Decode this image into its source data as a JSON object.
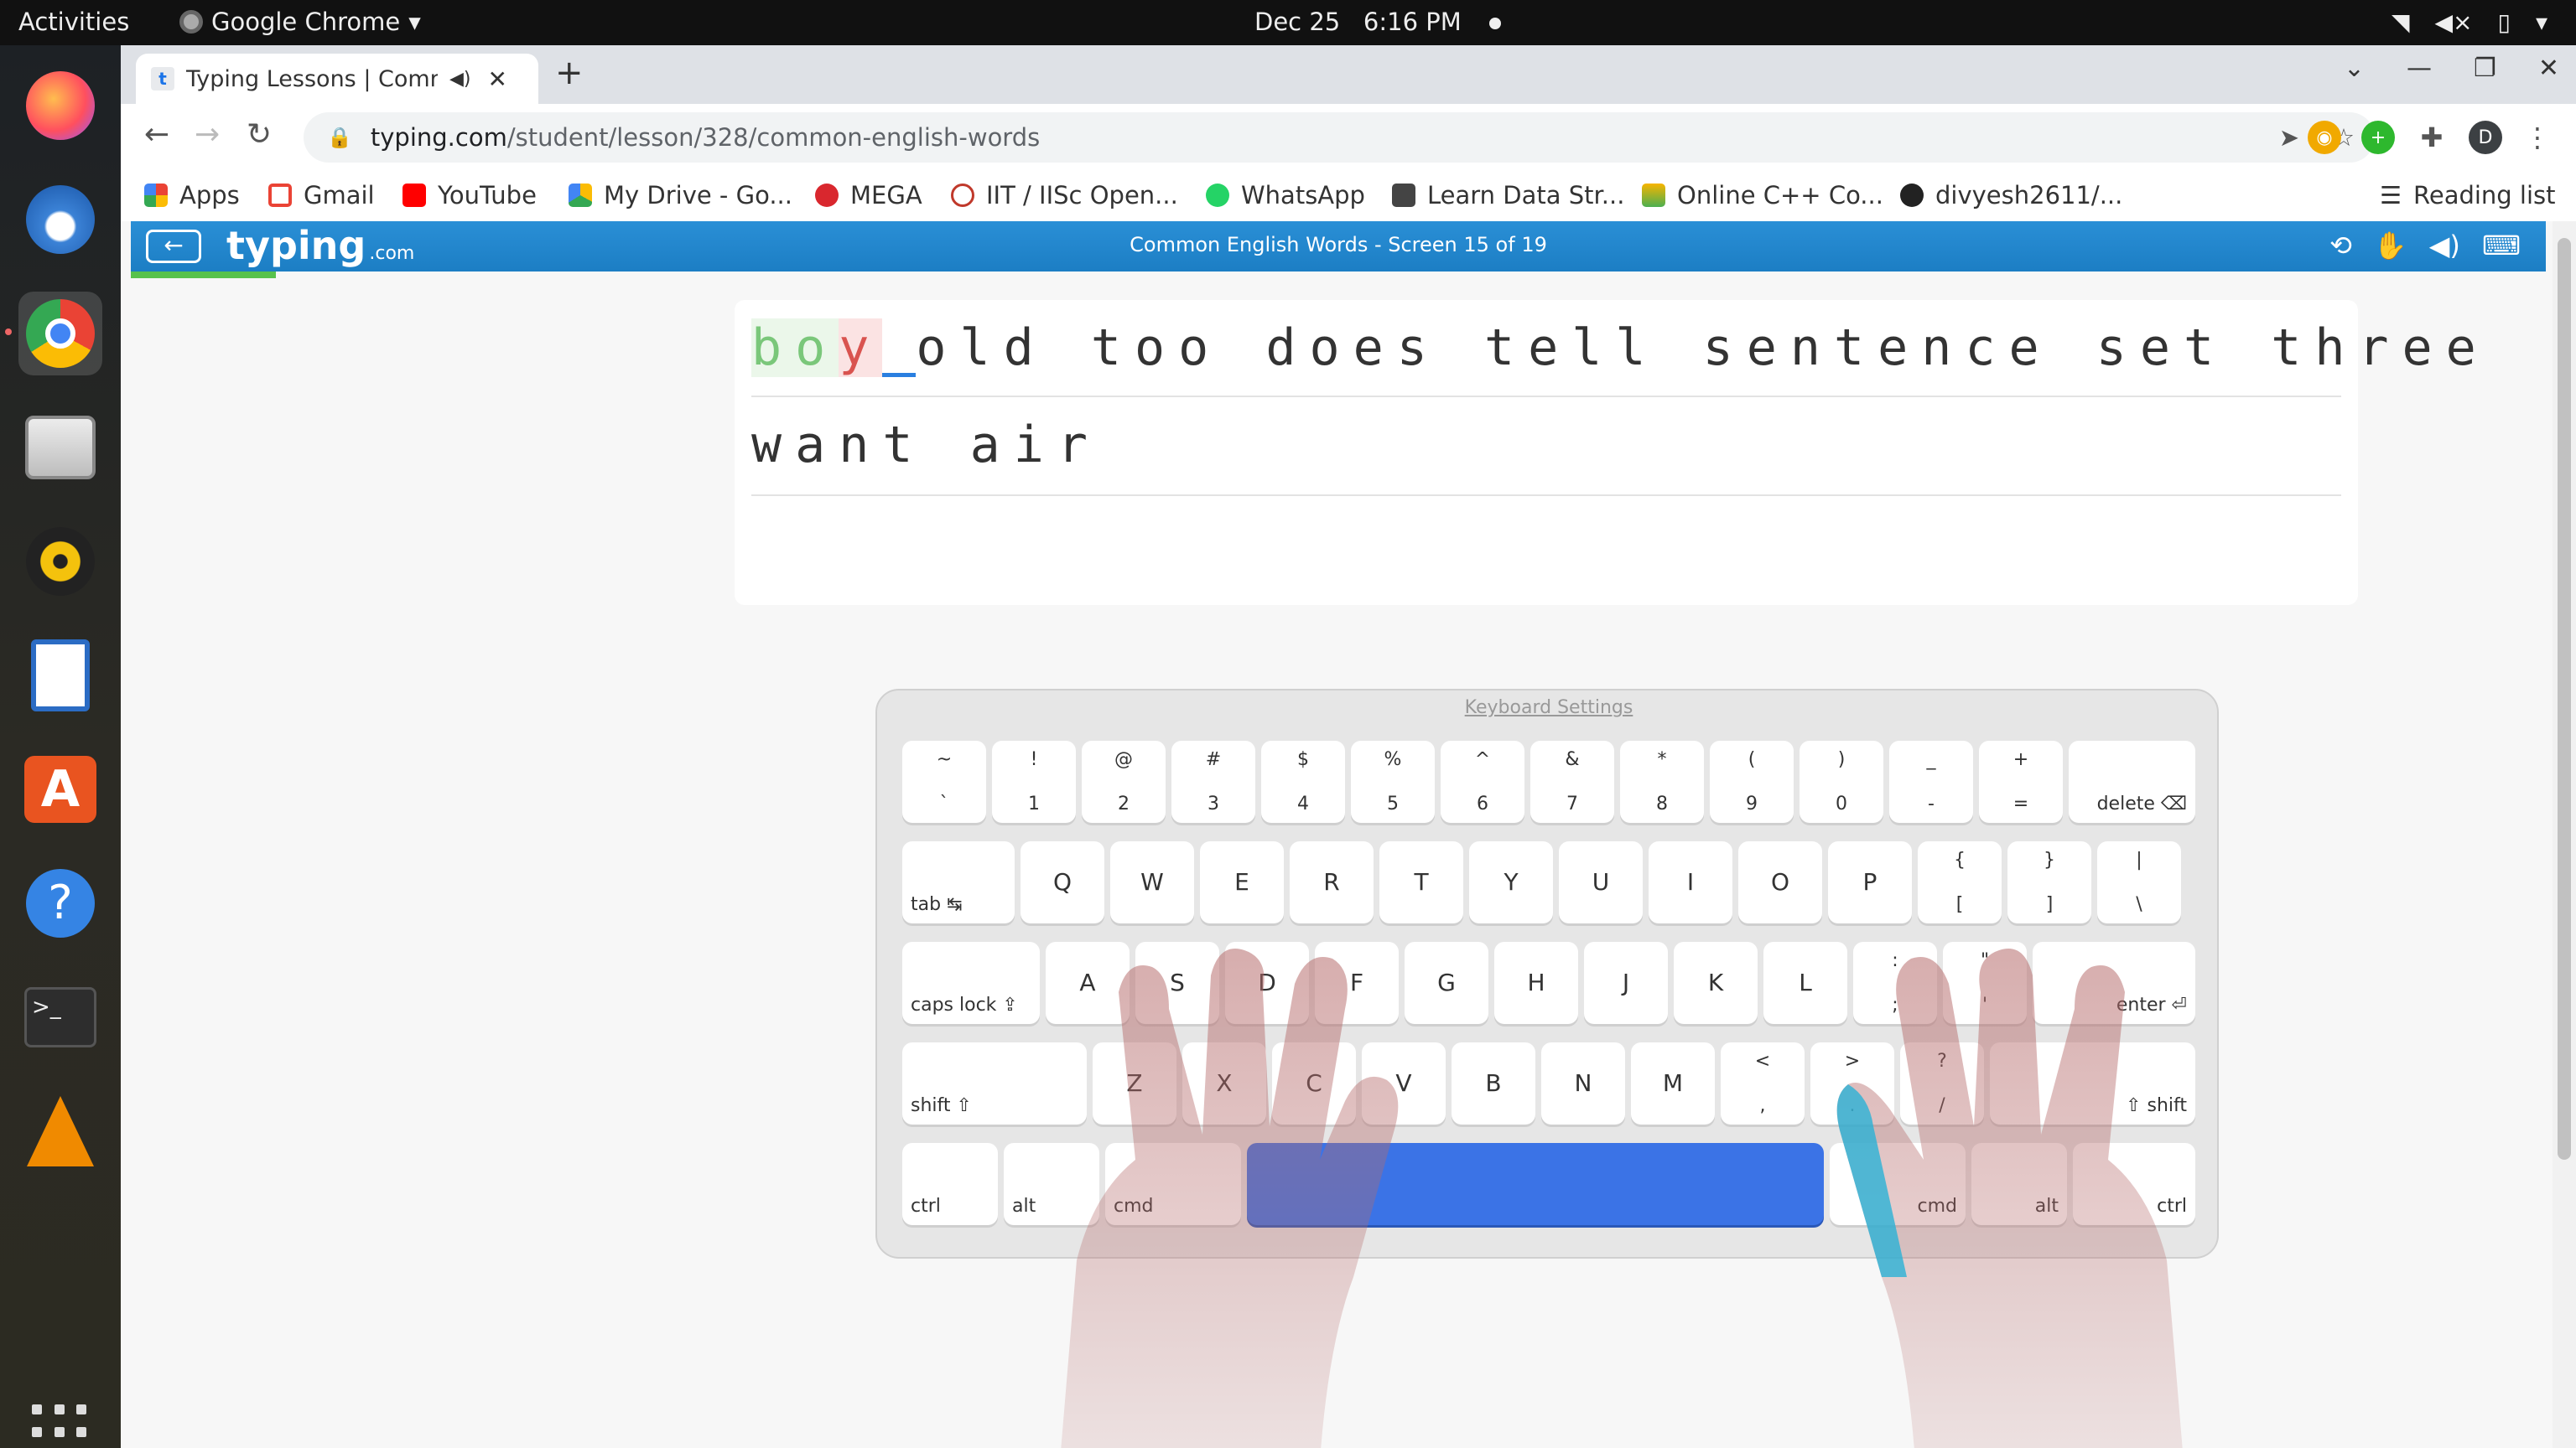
{
  "topbar": {
    "activities": "Activities",
    "app_name": "Google Chrome",
    "date": "Dec 25",
    "time": "6:16 PM"
  },
  "dock": {
    "apps": [
      "firefox-icon",
      "thunderbird-icon",
      "chrome-icon",
      "files-icon",
      "rhythmbox-icon",
      "writer-icon",
      "software-icon",
      "help-icon",
      "terminal-icon",
      "vlc-icon"
    ]
  },
  "browser": {
    "tab_title": "Typing Lessons | Comm",
    "url_host": "typing.com",
    "url_path": "/student/lesson/328/common-english-words",
    "profile_initial": "D",
    "bookmarks": [
      "Apps",
      "Gmail",
      "YouTube",
      "My Drive - Go...",
      "MEGA",
      "IIT / IISc Open...",
      "WhatsApp",
      "Learn Data Str...",
      "Online C++ Co...",
      "divyesh2611/..."
    ],
    "reading_list": "Reading list"
  },
  "lesson": {
    "logo": "typing",
    "logo_suffix": ".com",
    "title": "Common English Words - Screen 15 of 19",
    "line1_typed": [
      "b",
      "o",
      "y"
    ],
    "line1_rest": "old too does tell sentence set three",
    "line2": "want air",
    "progress_fraction": 0.06
  },
  "keyboard": {
    "settings_label": "Keyboard Settings",
    "row1": [
      [
        "~",
        "`"
      ],
      [
        "!",
        "1"
      ],
      [
        "@",
        "2"
      ],
      [
        "#",
        "3"
      ],
      [
        "$",
        "4"
      ],
      [
        "%",
        "5"
      ],
      [
        "^",
        "6"
      ],
      [
        "&",
        "7"
      ],
      [
        "*",
        "8"
      ],
      [
        "(",
        "9"
      ],
      [
        ")",
        "0"
      ],
      [
        "_",
        "-"
      ],
      [
        "+",
        "="
      ]
    ],
    "delete": "delete ⌫",
    "tab": "tab ↹",
    "row2": [
      "Q",
      "W",
      "E",
      "R",
      "T",
      "Y",
      "U",
      "I",
      "O",
      "P"
    ],
    "row2_sym": [
      [
        "{",
        "["
      ],
      [
        "}",
        "]"
      ],
      [
        "|",
        "\\"
      ]
    ],
    "caps": "caps lock ⇪",
    "row3": [
      "A",
      "S",
      "D",
      "F",
      "G",
      "H",
      "J",
      "K",
      "L"
    ],
    "row3_sym": [
      [
        ":",
        ";"
      ],
      [
        "\"",
        "'"
      ]
    ],
    "enter": "enter ⏎",
    "shift_l": "shift ⇧",
    "row4": [
      "Z",
      "X",
      "C",
      "V",
      "B",
      "N",
      "M"
    ],
    "row4_sym": [
      [
        "<",
        ","
      ],
      [
        ">",
        "."
      ],
      [
        "?",
        "/"
      ]
    ],
    "shift_r": "⇧ shift",
    "ctrl": "ctrl",
    "alt": "alt",
    "cmd": "cmd"
  }
}
